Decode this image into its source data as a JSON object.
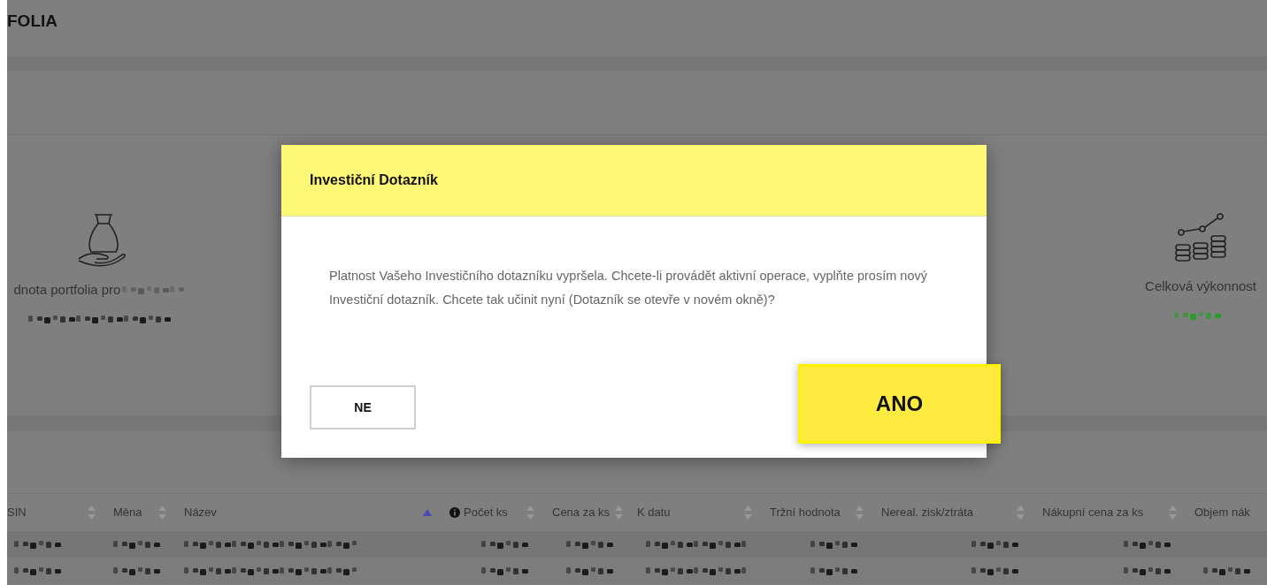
{
  "page": {
    "title": "FOLIA"
  },
  "stats": [
    {
      "kind": "portfolio",
      "label": "dnota portfolia pro"
    },
    {
      "kind": "performance",
      "label": "Celková výkonnost"
    }
  ],
  "table": {
    "columns": [
      {
        "label": "SIN",
        "sorted": false
      },
      {
        "label": "Měna",
        "sorted": false
      },
      {
        "label": "Název",
        "sorted": true
      },
      {
        "label": "Počet ks",
        "sorted": false,
        "info": true
      },
      {
        "label": "Cena za ks",
        "sorted": false
      },
      {
        "label": "K datu",
        "sorted": false
      },
      {
        "label": "Tržní hodnota",
        "sorted": false
      },
      {
        "label": "Nereal. zisk/ztráta",
        "sorted": false
      },
      {
        "label": "Nákupní cena za ks",
        "sorted": false
      },
      {
        "label": "Objem nák"
      }
    ],
    "rows": [
      {
        "cells": [
          {
            "kind": "blurred"
          },
          {
            "kind": "blurred"
          },
          {
            "kind": "blurred"
          },
          {
            "kind": "blurred"
          },
          {
            "kind": "blurred"
          },
          {
            "kind": "blurred"
          },
          {
            "kind": "blurred"
          },
          {
            "kind": "blurred"
          },
          {
            "kind": "blurred"
          },
          {
            "kind": "empty"
          }
        ]
      },
      {
        "cells": [
          {
            "kind": "blurred"
          },
          {
            "kind": "blurred"
          },
          {
            "kind": "blurred"
          },
          {
            "kind": "blurred"
          },
          {
            "kind": "blurred"
          },
          {
            "kind": "blurred"
          },
          {
            "kind": "blurred"
          },
          {
            "kind": "blurred"
          },
          {
            "kind": "blurred"
          },
          {
            "kind": "blurred"
          }
        ]
      }
    ]
  },
  "dialog": {
    "title": "Investiční Dotazník",
    "message": "Platnost Vašeho Investičního dotazníku vypršela. Chcete-li provádět aktivní operace, vyplňte prosím nový Investiční dotazník. Chcete tak učinit nyní (Dotazník se otevře v novém okně)?",
    "buttons": [
      {
        "kind": "secondary",
        "label": "NE"
      },
      {
        "kind": "primary",
        "label": "ANO"
      }
    ]
  }
}
